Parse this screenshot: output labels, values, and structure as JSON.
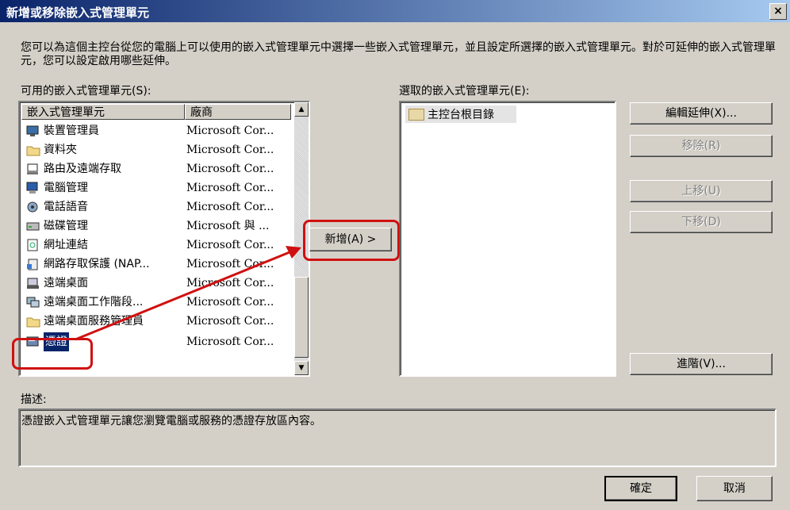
{
  "window": {
    "title": "新增或移除嵌入式管理單元",
    "close_label": "×"
  },
  "description_text": "您可以為這個主控台從您的電腦上可以使用的嵌入式管理單元中選擇一些嵌入式管理單元，並且設定所選擇的嵌入式管理單元。對於可延伸的嵌入式管理單元，您可以設定啟用哪些延伸。",
  "available": {
    "label": "可用的嵌入式管理單元(S):",
    "col_name": "嵌入式管理單元",
    "col_vendor": "廠商",
    "items": [
      {
        "name": "裝置管理員",
        "vendor": "Microsoft Cor...",
        "icon": "device-manager-icon"
      },
      {
        "name": "資料夾",
        "vendor": "Microsoft Cor...",
        "icon": "folder-icon"
      },
      {
        "name": "路由及遠端存取",
        "vendor": "Microsoft Cor...",
        "icon": "routing-icon"
      },
      {
        "name": "電腦管理",
        "vendor": "Microsoft Cor...",
        "icon": "computer-management-icon"
      },
      {
        "name": "電話語音",
        "vendor": "Microsoft Cor...",
        "icon": "telephony-icon"
      },
      {
        "name": "磁碟管理",
        "vendor": "Microsoft 與 ...",
        "icon": "disk-management-icon"
      },
      {
        "name": "網址連結",
        "vendor": "Microsoft Cor...",
        "icon": "link-icon"
      },
      {
        "name": "網路存取保護 (NAP...",
        "vendor": "Microsoft Cor...",
        "icon": "nap-icon"
      },
      {
        "name": "遠端桌面",
        "vendor": "Microsoft Cor...",
        "icon": "remote-desktop-icon"
      },
      {
        "name": "遠端桌面工作階段...",
        "vendor": "Microsoft Cor...",
        "icon": "rd-session-icon"
      },
      {
        "name": "遠端桌面服務管理員",
        "vendor": "Microsoft Cor...",
        "icon": "folder-icon"
      },
      {
        "name": "憑證",
        "vendor": "Microsoft Cor...",
        "icon": "certificates-icon",
        "selected": true
      }
    ]
  },
  "add_button": "新增(A) >",
  "selected": {
    "label": "選取的嵌入式管理單元(E):",
    "items": [
      {
        "name": "主控台根目錄",
        "icon": "folder-icon"
      }
    ]
  },
  "buttons": {
    "edit_extensions": "編輯延伸(X)...",
    "remove": "移除(R)",
    "move_up": "上移(U)",
    "move_down": "下移(D)",
    "advanced": "進階(V)...",
    "ok": "確定",
    "cancel": "取消"
  },
  "description": {
    "label": "描述:",
    "text": "憑證嵌入式管理單元讓您瀏覽電腦或服務的憑證存放區內容。"
  },
  "colors": {
    "annotation_red": "#d01010",
    "selection_blue": "#0a246a"
  }
}
